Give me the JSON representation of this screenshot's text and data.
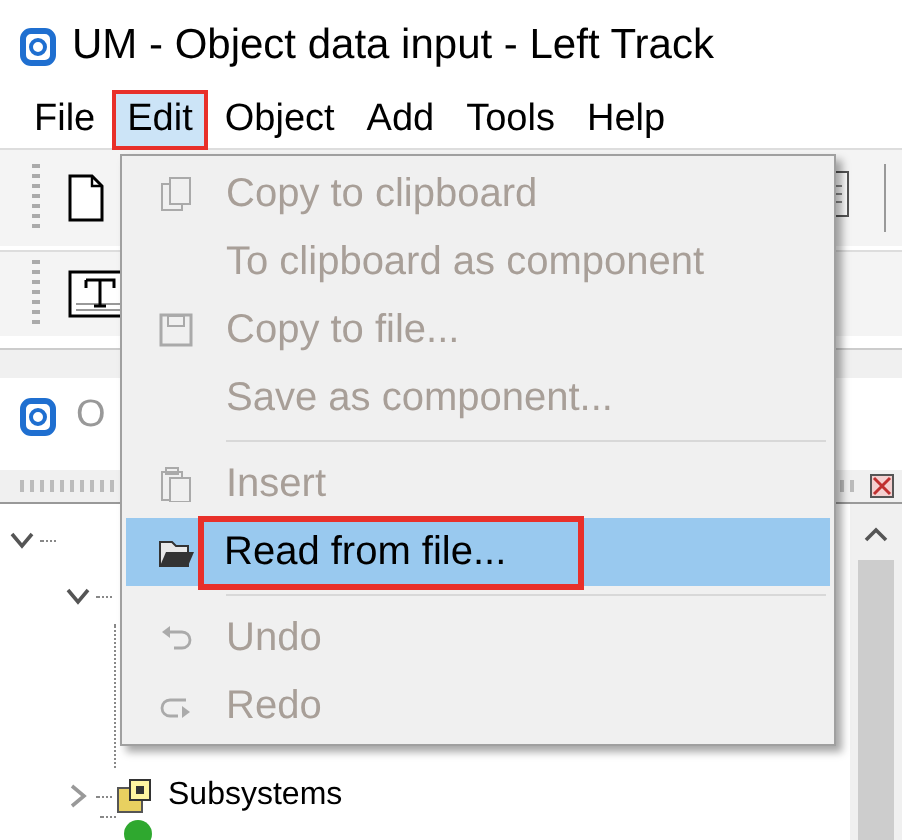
{
  "window": {
    "title": "UM - Object data input - Left Track"
  },
  "menubar": [
    {
      "label": "File",
      "selected": false,
      "highlighted": false
    },
    {
      "label": "Edit",
      "selected": true,
      "highlighted": true
    },
    {
      "label": "Object",
      "selected": false,
      "highlighted": false
    },
    {
      "label": "Add",
      "selected": false,
      "highlighted": false
    },
    {
      "label": "Tools",
      "selected": false,
      "highlighted": false
    },
    {
      "label": "Help",
      "selected": false,
      "highlighted": false
    }
  ],
  "panel": {
    "title": "O"
  },
  "tree": [
    {
      "expanded": true,
      "children": [
        {
          "expanded": true
        },
        {
          "label": "Subsystems",
          "expanded": false
        },
        {
          "kind": "node"
        }
      ]
    }
  ],
  "menu": [
    {
      "kind": "item",
      "label": "Copy to clipboard",
      "disabled": true,
      "selected": false,
      "highlighted": false
    },
    {
      "kind": "item",
      "label": "To clipboard as component",
      "disabled": true,
      "selected": false,
      "highlighted": false
    },
    {
      "kind": "item",
      "label": "Copy to file...",
      "disabled": true,
      "selected": false,
      "highlighted": false
    },
    {
      "kind": "item",
      "label": "Save as component...",
      "disabled": true,
      "selected": false,
      "highlighted": false
    },
    {
      "kind": "separator"
    },
    {
      "kind": "item",
      "label": "Insert",
      "disabled": true,
      "selected": false,
      "highlighted": false
    },
    {
      "kind": "item",
      "label": "Read from file...",
      "disabled": false,
      "selected": true,
      "highlighted": true
    },
    {
      "kind": "separator"
    },
    {
      "kind": "item",
      "label": "Undo",
      "disabled": true,
      "selected": false,
      "highlighted": false
    },
    {
      "kind": "item",
      "label": "Redo",
      "disabled": true,
      "selected": false,
      "highlighted": false
    }
  ]
}
